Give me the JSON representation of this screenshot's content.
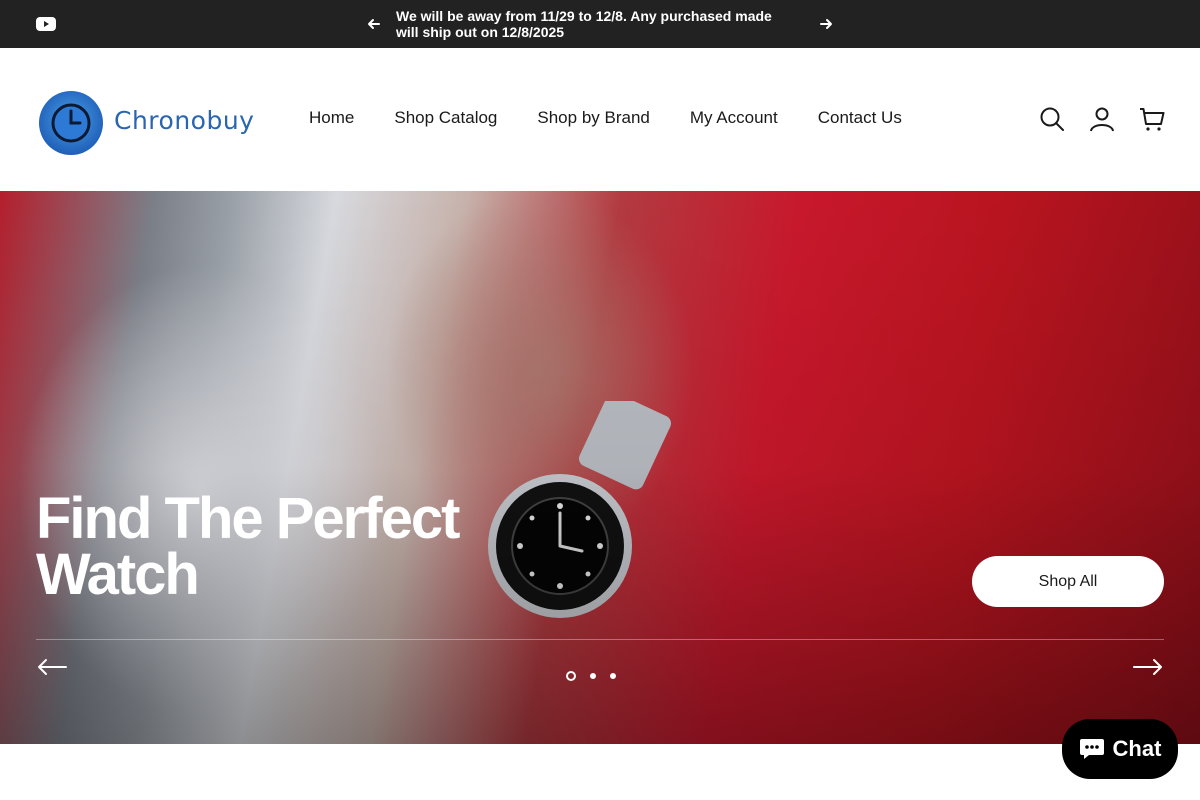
{
  "announcement": {
    "text": "We will be away from 11/29 to 12/8. Any purchased made will ship out on 12/8/2025"
  },
  "brand": {
    "name": "Chronobuy"
  },
  "nav": {
    "items": [
      {
        "label": "Home"
      },
      {
        "label": "Shop Catalog"
      },
      {
        "label": "Shop by Brand"
      },
      {
        "label": "My Account"
      },
      {
        "label": "Contact Us"
      }
    ]
  },
  "hero": {
    "title": "Find The Perfect Watch",
    "cta": "Shop All",
    "slides": {
      "count": 3,
      "active": 1
    }
  },
  "chat": {
    "label": "Chat"
  },
  "icons": [
    "youtube-icon",
    "arrow-left-icon",
    "arrow-right-icon",
    "search-icon",
    "account-icon",
    "cart-icon",
    "chat-icon"
  ],
  "colors": {
    "announce_bg": "#222222",
    "brand_blue": "#2a66b0",
    "hero_red": "#c8182c"
  }
}
